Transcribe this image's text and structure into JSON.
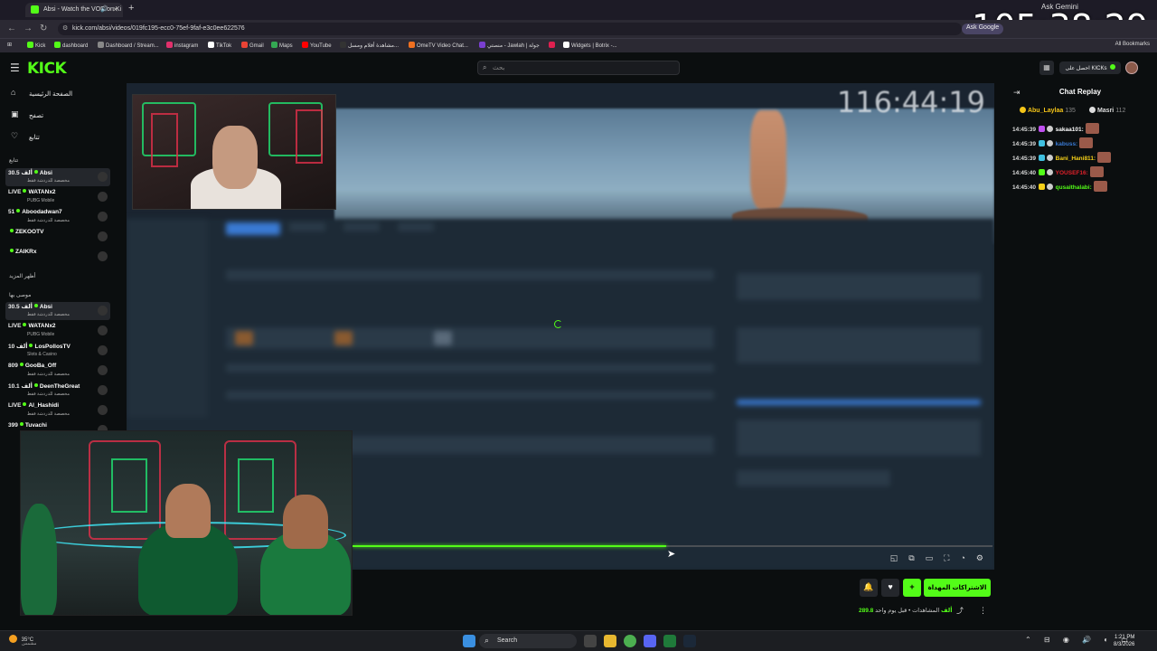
{
  "browser": {
    "tab_title": "Absi - Watch the VOD on Ki",
    "new_tab": "+",
    "ask_gemini": "Ask Gemini",
    "url": "kick.com/absi/videos/019fc195-ecc0-75ef-9faf-e3c0ee622576",
    "gemini_button": "Ask Google",
    "bookmarks": [
      {
        "label": "Kick",
        "color": "#53fc18"
      },
      {
        "label": "dashboard",
        "color": "#53fc18"
      },
      {
        "label": "Dashboard / Stream...",
        "color": "#888888"
      },
      {
        "label": "instagram",
        "color": "#e1306c"
      },
      {
        "label": "TikTok",
        "color": "#ffffff"
      },
      {
        "label": "Gmail",
        "color": "#ea4335"
      },
      {
        "label": "Maps",
        "color": "#34a853"
      },
      {
        "label": "YouTube",
        "color": "#ff0000"
      },
      {
        "label": "مشاهدة أفلام ومسل...",
        "color": "#333333"
      },
      {
        "label": "OmeTV Video Chat...",
        "color": "#f07020"
      },
      {
        "label": "منصتي - Jawlah | جولة",
        "color": "#7a3fd0"
      },
      {
        "label": "",
        "color": "#e02050"
      },
      {
        "label": "Widgets | Botrix -...",
        "color": "#ffffff"
      }
    ],
    "all_bookmarks": "All Bookmarks"
  },
  "overlay_timer": "105:38:29",
  "kick": {
    "logo": "KICK",
    "search_placeholder": "بحث",
    "kicks_button": "احصل على KICKs"
  },
  "sidebar": {
    "nav": [
      {
        "label": "الصفحة الرئيسية",
        "icon": "home-icon"
      },
      {
        "label": "تصفح",
        "icon": "browse-icon"
      },
      {
        "label": "تتابع",
        "icon": "heart-icon"
      }
    ],
    "following_label": "تتابع",
    "following": [
      {
        "count": "30.5 ألف",
        "name": "Absi",
        "sub": "مخصصة للدردشة فقط",
        "active": true
      },
      {
        "count": "LIVE",
        "name": "WATANx2",
        "sub": "PUBG Mobile",
        "active": false
      },
      {
        "count": "51",
        "name": "Aboodadwan7",
        "sub": "مخصصة للدردشة فقط",
        "active": false
      },
      {
        "count": "",
        "name": "ZEKOOTV",
        "sub": "",
        "active": false
      },
      {
        "count": "",
        "name": "ZAIKRx",
        "sub": "",
        "active": false
      }
    ],
    "show_more": "أظهر المزيد",
    "recommended_label": "موصى بها",
    "recommended": [
      {
        "count": "30.5 ألف",
        "name": "Absi",
        "sub": "مخصصة للدردشة فقط",
        "active": true
      },
      {
        "count": "LIVE",
        "name": "WATANx2",
        "sub": "PUBG Mobile",
        "active": false
      },
      {
        "count": "10 ألف",
        "name": "LosPollosTV",
        "sub": "Slots & Casino",
        "active": false
      },
      {
        "count": "809",
        "name": "GooBa_Off",
        "sub": "مخصصة للدردشة فقط",
        "active": false
      },
      {
        "count": "10.1 ألف",
        "name": "DeenTheGreat",
        "sub": "مخصصة للدردشة فقط",
        "active": false
      },
      {
        "count": "LIVE",
        "name": "Al_Hashidi",
        "sub": "مخصصة للدردشة فقط",
        "active": false
      },
      {
        "count": "399",
        "name": "Tuvachi",
        "sub": "",
        "active": false
      }
    ]
  },
  "video": {
    "timer": "116:44:19",
    "progress": 0.49
  },
  "chat": {
    "title": "Chat Replay",
    "pinned": [
      {
        "name": "Abu_Laylaa",
        "count": "135",
        "color": "#f5c518"
      },
      {
        "name": "Masri",
        "count": "112",
        "color": "#dddddd"
      }
    ],
    "messages": [
      {
        "time": "14:45:39",
        "user": "sakaa101:",
        "color": "#ffffff",
        "badge": "#c050f0"
      },
      {
        "time": "14:45:39",
        "user": "kabuss:",
        "color": "#3a7bd5",
        "badge": "#40c0e0"
      },
      {
        "time": "14:45:39",
        "user": "Bani_Hani811:",
        "color": "#f5d018",
        "badge": "#40c0e0"
      },
      {
        "time": "14:45:40",
        "user": "YOUSEF16:",
        "color": "#e0202a",
        "badge": "#53fc18"
      },
      {
        "time": "14:45:40",
        "user": "qusaithalabi:",
        "color": "#53fc18",
        "badge": "#f5d018"
      }
    ]
  },
  "actions": {
    "subscribe": "الاشتراكات المهداة",
    "views": "289.8 ألف",
    "views_label": "المشاهدات",
    "ago": "قبل يوم واحد"
  },
  "taskbar": {
    "temp": "35°C",
    "weather_sub": "مشمس",
    "search": "Search",
    "time": "1:21 PM",
    "date": "8/3/2026"
  }
}
